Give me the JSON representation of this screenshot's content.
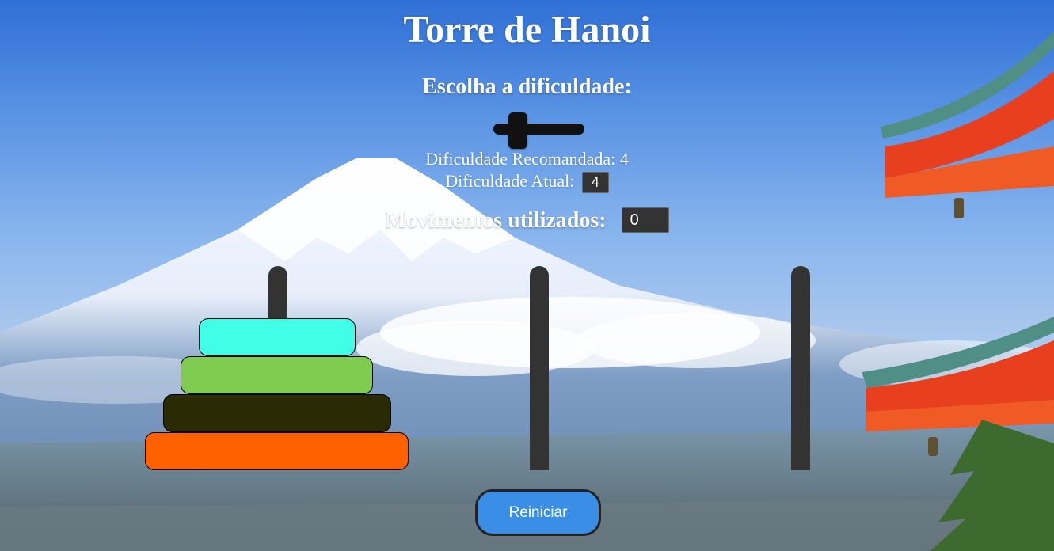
{
  "title": "Torre de Hanoi",
  "difficulty": {
    "heading": "Escolha a dificuldade:",
    "slider_value": 4,
    "recommended_label": "Dificuldade Recomandada: 4",
    "current_label": "Dificuldade Atual:",
    "current_value": "4"
  },
  "moves": {
    "label": "Movimentos utilizados:",
    "value": "0"
  },
  "disks": [
    {
      "size": 1,
      "color": "#40ffe6"
    },
    {
      "size": 2,
      "color": "#80cc50"
    },
    {
      "size": 3,
      "color": "#2a2a05"
    },
    {
      "size": 4,
      "color": "#ff6000"
    }
  ],
  "restart_label": "Reiniciar",
  "colors": {
    "pole": "#333333",
    "button": "#3a8ee6",
    "text": "#ffffff"
  }
}
